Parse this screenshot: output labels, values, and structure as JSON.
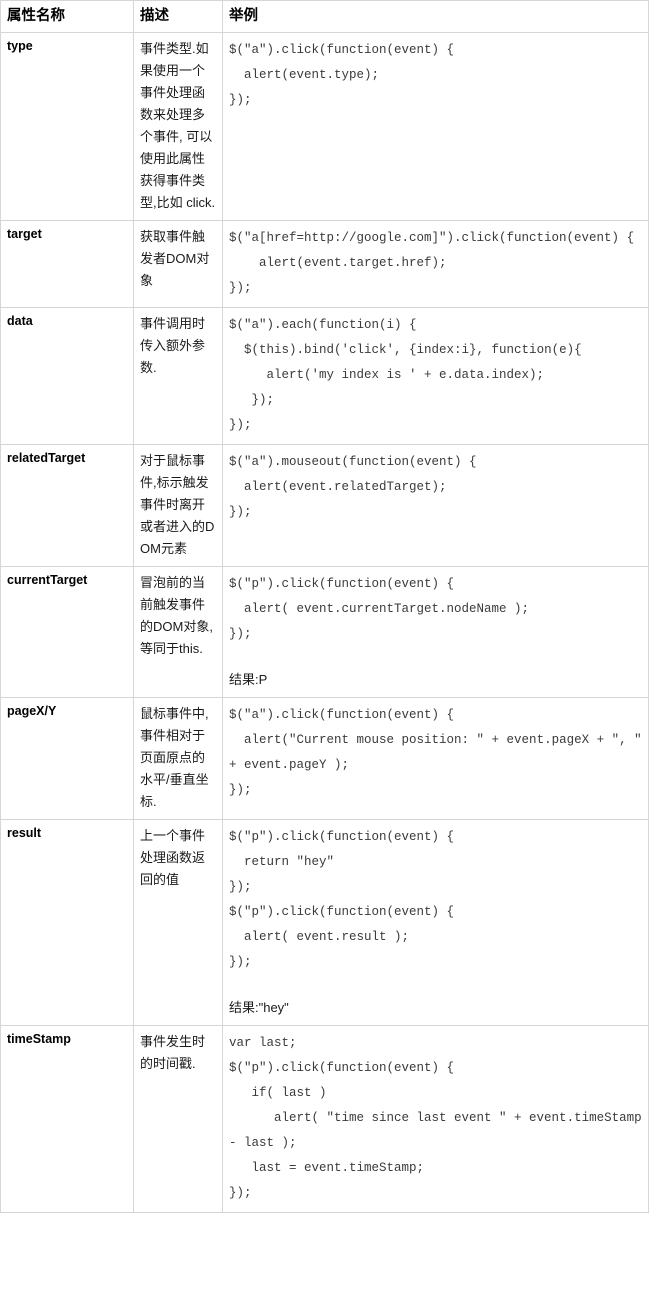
{
  "table": {
    "headers": {
      "name": "属性名称",
      "description": "描述",
      "example": "举例"
    },
    "rows": [
      {
        "name": "type",
        "description": "事件类型.如果使用一个事件处理函数来处理多个事件, 可以使用此属性获得事件类型,比如 click.",
        "code": "$(\"a\").click(function(event) {\n  alert(event.type);\n});",
        "result": ""
      },
      {
        "name": "target",
        "description": "获取事件触发者DOM对象",
        "code": "$(\"a[href=http://google.com]\").click(function(event) {\n    alert(event.target.href);\n});",
        "result": ""
      },
      {
        "name": "data",
        "description": "事件调用时传入额外参数.",
        "code": "$(\"a\").each(function(i) {\n  $(this).bind('click', {index:i}, function(e){\n     alert('my index is ' + e.data.index);\n   });\n});",
        "result": ""
      },
      {
        "name": "relatedTarget",
        "description": "对于鼠标事件,标示触发事件时离开或者进入的DOM元素",
        "code": "$(\"a\").mouseout(function(event) {\n  alert(event.relatedTarget);\n});",
        "result": ""
      },
      {
        "name": "currentTarget",
        "description": "冒泡前的当前触发事件的DOM对象, 等同于this.",
        "code": "$(\"p\").click(function(event) {\n  alert( event.currentTarget.nodeName );\n});",
        "result": "结果:P"
      },
      {
        "name": "pageX/Y",
        "description": "鼠标事件中,事件相对于页面原点的水平/垂直坐标.",
        "code": "$(\"a\").click(function(event) {\n  alert(\"Current mouse position: \" + event.pageX + \", \" + event.pageY );\n});",
        "result": ""
      },
      {
        "name": "result",
        "description": "上一个事件处理函数返回的值",
        "code": "$(\"p\").click(function(event) {\n  return \"hey\"\n});\n$(\"p\").click(function(event) {\n  alert( event.result );\n});",
        "result": "结果:\"hey\""
      },
      {
        "name": "timeStamp",
        "description": "事件发生时的时间戳.",
        "code": "var last;\n$(\"p\").click(function(event) {\n   if( last )\n      alert( \"time since last event \" + event.timeStamp - last );\n   last = event.timeStamp;\n});",
        "result": ""
      }
    ]
  },
  "colors": {
    "border": "#d6d6d6",
    "code_text": "#3a3a3a",
    "text": "#000000",
    "background": "#ffffff"
  }
}
